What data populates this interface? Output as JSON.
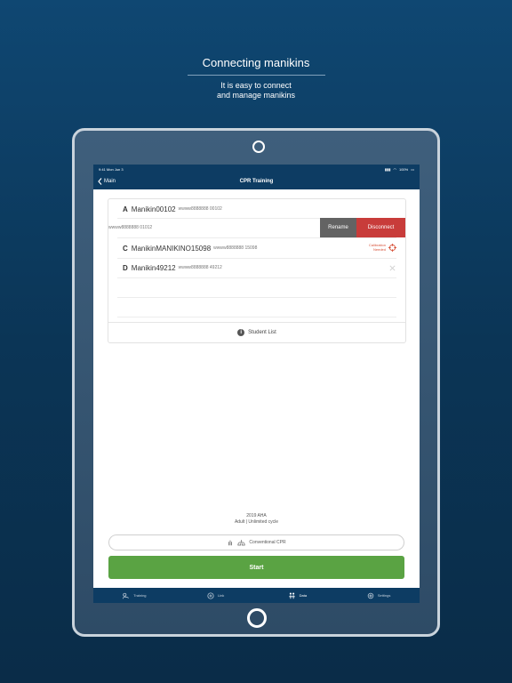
{
  "promo": {
    "headline": "Connecting manikins",
    "subline_1": "It is easy to connect",
    "subline_2": "and manage manikins"
  },
  "status_bar": {
    "time": "9:41",
    "date": "Mon Jun 3",
    "battery": "100%"
  },
  "nav": {
    "back_label": "Main",
    "title": "CPR Training"
  },
  "manikins": {
    "a": {
      "letter": "A",
      "name": "Manikin00102",
      "serial": "wwww8888888 00102"
    },
    "b": {
      "serial": "wwww8888888 01012"
    },
    "c": {
      "letter": "C",
      "name": "ManikinMANIKINO15098",
      "serial": "wwww8888888 15098",
      "status_1": "Calibration",
      "status_2": "Needed"
    },
    "d": {
      "letter": "D",
      "name": "Manikin49212",
      "serial": "wwww8888888 49212"
    }
  },
  "actions": {
    "rename": "Rename",
    "disconnect": "Disconnect"
  },
  "student_list": "Student List",
  "protocol": {
    "line1": "2019 AHA",
    "line2": "Adult | Unlimited cycle"
  },
  "mode_button": "Conventional CPR",
  "start_button": "Start",
  "tabs": [
    {
      "label": "Training",
      "icon": "training-icon"
    },
    {
      "label": "Link",
      "icon": "link-icon"
    },
    {
      "label": "Data",
      "icon": "data-icon"
    },
    {
      "label": "Settings",
      "icon": "settings-icon"
    }
  ],
  "colors": {
    "nav": "#0d3c63",
    "start": "#5aa343",
    "disconnect": "#c83c3a",
    "rename": "#636363",
    "warning": "#d8543c"
  }
}
